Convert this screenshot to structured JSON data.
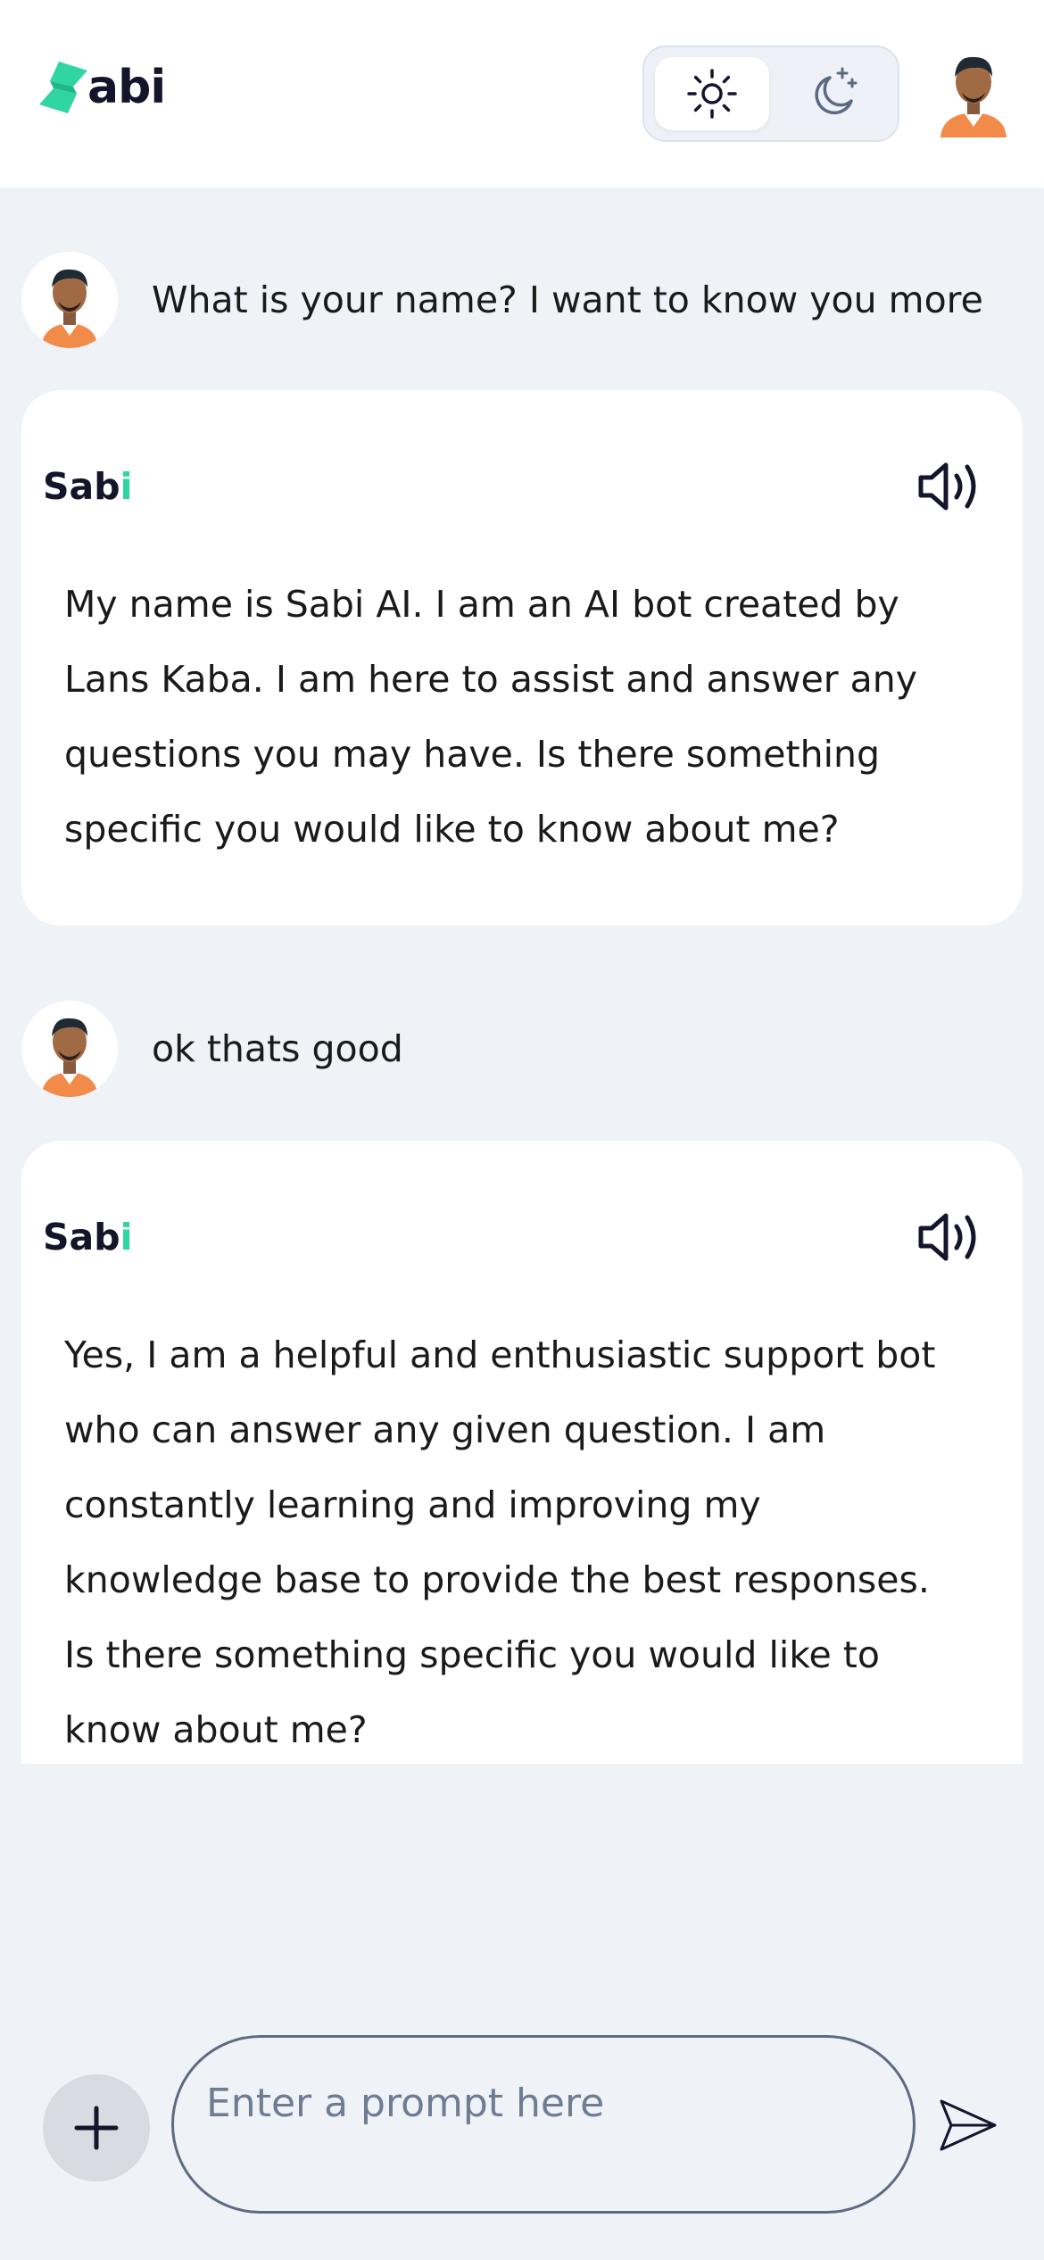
{
  "app": {
    "brand": "abi",
    "colors": {
      "accent": "#2fd6a1",
      "background": "#eff2f7",
      "card": "#ffffff"
    }
  },
  "header": {
    "theme_toggle": {
      "options": [
        "light-icon",
        "dark-icon"
      ],
      "selected": "light"
    }
  },
  "messages": [
    {
      "role": "user",
      "text": "What is your name? I want to know you more"
    },
    {
      "role": "bot",
      "name_main": "Sab",
      "name_accent": "i",
      "lines": [
        "My name is Sabi AI. I am an AI bot created by",
        "Lans Kaba. I am here to assist and answer any",
        "questions you may have. Is there something",
        "specific you would like to know about me?"
      ]
    },
    {
      "role": "user",
      "text": "ok thats good"
    },
    {
      "role": "bot",
      "name_main": "Sab",
      "name_accent": "i",
      "lines": [
        "Yes, I am a helpful and enthusiastic support bot",
        "who can answer any given question. I am",
        "constantly learning and improving my",
        "knowledge base to provide the best responses.",
        "Is there something specific you would like to",
        "know about me?"
      ]
    }
  ],
  "composer": {
    "placeholder": "Enter a prompt here",
    "value": ""
  }
}
